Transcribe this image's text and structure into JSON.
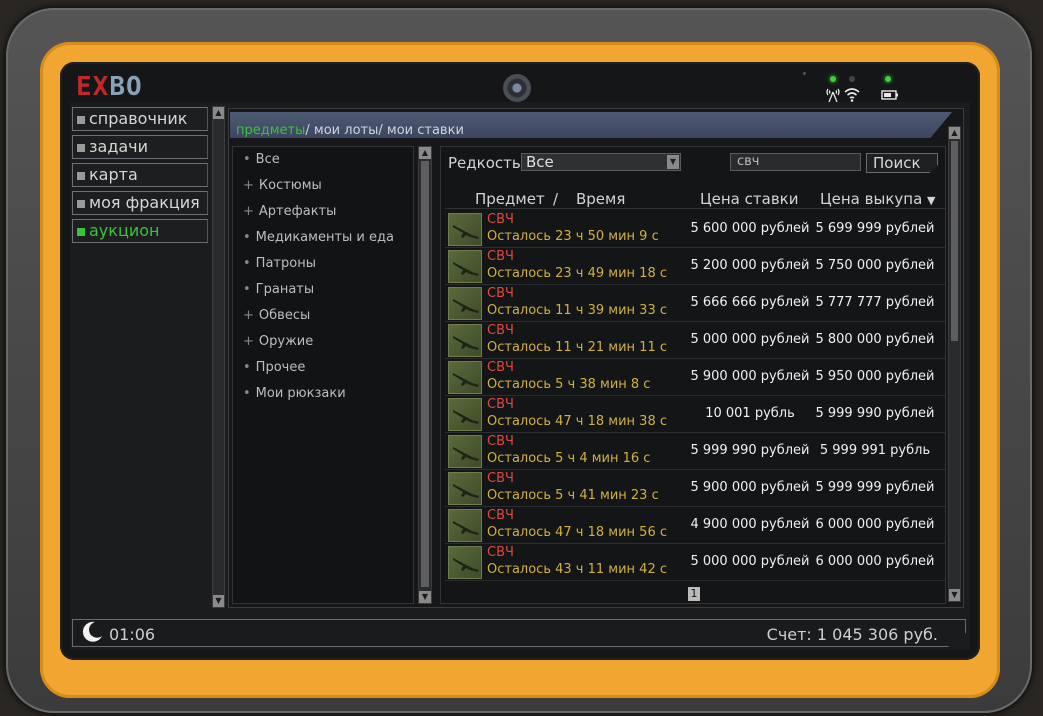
{
  "logo": {
    "part1": "EX",
    "part2": "BO"
  },
  "menu": [
    {
      "label": "справочник",
      "active": false
    },
    {
      "label": "задачи",
      "active": false
    },
    {
      "label": "карта",
      "active": false
    },
    {
      "label": "моя фракция",
      "active": false
    },
    {
      "label": "аукцион",
      "active": true
    }
  ],
  "tabs": {
    "items": "предметы",
    "lots": "мои лоты",
    "bids": "мои ставки",
    "sep": "/"
  },
  "categories": [
    {
      "bullet": "•",
      "label": "Все"
    },
    {
      "bullet": "+",
      "label": "Костюмы"
    },
    {
      "bullet": "+",
      "label": "Артефакты"
    },
    {
      "bullet": "•",
      "label": "Медикаменты и еда"
    },
    {
      "bullet": "•",
      "label": "Патроны"
    },
    {
      "bullet": "•",
      "label": "Гранаты"
    },
    {
      "bullet": "+",
      "label": "Обвесы"
    },
    {
      "bullet": "+",
      "label": "Оружие"
    },
    {
      "bullet": "•",
      "label": "Прочее"
    },
    {
      "bullet": "•",
      "label": "Мои рюкзаки"
    }
  ],
  "filter": {
    "label": "Редкость",
    "value": "Все"
  },
  "search": {
    "value": "свч",
    "button": "Поиск"
  },
  "columns": {
    "item": "Предмет",
    "slash": "/",
    "time": "Время",
    "bid": "Цена ставки",
    "buyout": "Цена выкупа",
    "sort_icon": "▼"
  },
  "rows": [
    {
      "name": "СВЧ",
      "time": "Осталось 23 ч 50 мин 9 с",
      "bid": "5 600 000 рублей",
      "buyout": "5 699 999 рублей"
    },
    {
      "name": "СВЧ",
      "time": "Осталось 23 ч 49 мин 18 с",
      "bid": "5 200 000 рублей",
      "buyout": "5 750 000 рублей"
    },
    {
      "name": "СВЧ",
      "time": "Осталось 11 ч 39 мин 33 с",
      "bid": "5 666 666 рублей",
      "buyout": "5 777 777 рублей"
    },
    {
      "name": "СВЧ",
      "time": "Осталось 11 ч 21 мин 11 с",
      "bid": "5 000 000 рублей",
      "buyout": "5 800 000 рублей"
    },
    {
      "name": "СВЧ",
      "time": "Осталось 5 ч 38 мин 8 с",
      "bid": "5 900 000 рублей",
      "buyout": "5 950 000 рублей"
    },
    {
      "name": "СВЧ",
      "time": "Осталось 47 ч 18 мин 38 с",
      "bid": "10 001 рубль",
      "buyout": "5 999 990 рублей"
    },
    {
      "name": "СВЧ",
      "time": "Осталось 5 ч 4 мин 16 с",
      "bid": "5 999 990 рублей",
      "buyout": "5 999 991 рубль"
    },
    {
      "name": "СВЧ",
      "time": "Осталось 5 ч 41 мин 23 с",
      "bid": "5 900 000 рублей",
      "buyout": "5 999 999 рублей"
    },
    {
      "name": "СВЧ",
      "time": "Осталось 47 ч 18 мин 56 с",
      "bid": "4 900 000 рублей",
      "buyout": "6 000 000 рублей"
    },
    {
      "name": "СВЧ",
      "time": "Осталось 43 ч 11 мин 42 с",
      "bid": "5 000 000 рублей",
      "buyout": "6 000 000 рублей"
    }
  ],
  "pagination": {
    "current": "1"
  },
  "status": {
    "time": "01:06",
    "account": "Счет: 1 045 306 руб.",
    "moon_icon": "moon-icon"
  },
  "colors": {
    "accent": "#3ac33a",
    "item_name": "#e0483e",
    "timer": "#d2b040",
    "bezel": "#f0a630"
  }
}
